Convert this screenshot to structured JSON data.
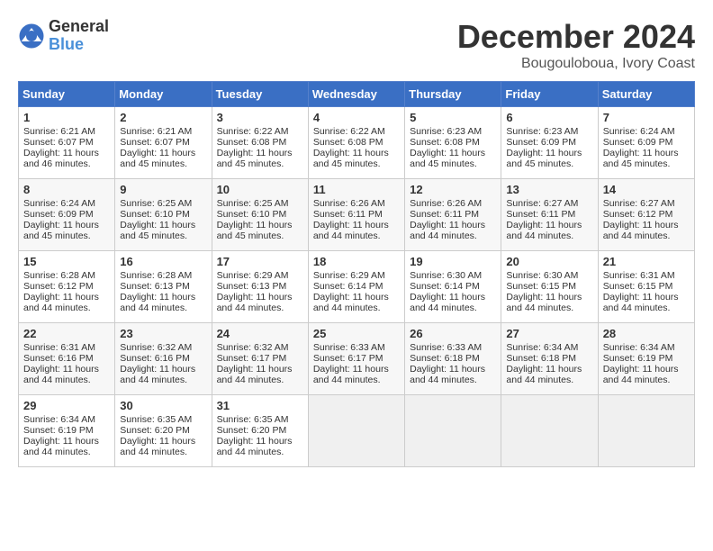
{
  "logo": {
    "general": "General",
    "blue": "Blue"
  },
  "title": "December 2024",
  "location": "Bougouloboua, Ivory Coast",
  "days_of_week": [
    "Sunday",
    "Monday",
    "Tuesday",
    "Wednesday",
    "Thursday",
    "Friday",
    "Saturday"
  ],
  "weeks": [
    [
      {
        "day": "1",
        "sunrise": "Sunrise: 6:21 AM",
        "sunset": "Sunset: 6:07 PM",
        "daylight": "Daylight: 11 hours and 46 minutes."
      },
      {
        "day": "2",
        "sunrise": "Sunrise: 6:21 AM",
        "sunset": "Sunset: 6:07 PM",
        "daylight": "Daylight: 11 hours and 45 minutes."
      },
      {
        "day": "3",
        "sunrise": "Sunrise: 6:22 AM",
        "sunset": "Sunset: 6:08 PM",
        "daylight": "Daylight: 11 hours and 45 minutes."
      },
      {
        "day": "4",
        "sunrise": "Sunrise: 6:22 AM",
        "sunset": "Sunset: 6:08 PM",
        "daylight": "Daylight: 11 hours and 45 minutes."
      },
      {
        "day": "5",
        "sunrise": "Sunrise: 6:23 AM",
        "sunset": "Sunset: 6:08 PM",
        "daylight": "Daylight: 11 hours and 45 minutes."
      },
      {
        "day": "6",
        "sunrise": "Sunrise: 6:23 AM",
        "sunset": "Sunset: 6:09 PM",
        "daylight": "Daylight: 11 hours and 45 minutes."
      },
      {
        "day": "7",
        "sunrise": "Sunrise: 6:24 AM",
        "sunset": "Sunset: 6:09 PM",
        "daylight": "Daylight: 11 hours and 45 minutes."
      }
    ],
    [
      {
        "day": "8",
        "sunrise": "Sunrise: 6:24 AM",
        "sunset": "Sunset: 6:09 PM",
        "daylight": "Daylight: 11 hours and 45 minutes."
      },
      {
        "day": "9",
        "sunrise": "Sunrise: 6:25 AM",
        "sunset": "Sunset: 6:10 PM",
        "daylight": "Daylight: 11 hours and 45 minutes."
      },
      {
        "day": "10",
        "sunrise": "Sunrise: 6:25 AM",
        "sunset": "Sunset: 6:10 PM",
        "daylight": "Daylight: 11 hours and 45 minutes."
      },
      {
        "day": "11",
        "sunrise": "Sunrise: 6:26 AM",
        "sunset": "Sunset: 6:11 PM",
        "daylight": "Daylight: 11 hours and 44 minutes."
      },
      {
        "day": "12",
        "sunrise": "Sunrise: 6:26 AM",
        "sunset": "Sunset: 6:11 PM",
        "daylight": "Daylight: 11 hours and 44 minutes."
      },
      {
        "day": "13",
        "sunrise": "Sunrise: 6:27 AM",
        "sunset": "Sunset: 6:11 PM",
        "daylight": "Daylight: 11 hours and 44 minutes."
      },
      {
        "day": "14",
        "sunrise": "Sunrise: 6:27 AM",
        "sunset": "Sunset: 6:12 PM",
        "daylight": "Daylight: 11 hours and 44 minutes."
      }
    ],
    [
      {
        "day": "15",
        "sunrise": "Sunrise: 6:28 AM",
        "sunset": "Sunset: 6:12 PM",
        "daylight": "Daylight: 11 hours and 44 minutes."
      },
      {
        "day": "16",
        "sunrise": "Sunrise: 6:28 AM",
        "sunset": "Sunset: 6:13 PM",
        "daylight": "Daylight: 11 hours and 44 minutes."
      },
      {
        "day": "17",
        "sunrise": "Sunrise: 6:29 AM",
        "sunset": "Sunset: 6:13 PM",
        "daylight": "Daylight: 11 hours and 44 minutes."
      },
      {
        "day": "18",
        "sunrise": "Sunrise: 6:29 AM",
        "sunset": "Sunset: 6:14 PM",
        "daylight": "Daylight: 11 hours and 44 minutes."
      },
      {
        "day": "19",
        "sunrise": "Sunrise: 6:30 AM",
        "sunset": "Sunset: 6:14 PM",
        "daylight": "Daylight: 11 hours and 44 minutes."
      },
      {
        "day": "20",
        "sunrise": "Sunrise: 6:30 AM",
        "sunset": "Sunset: 6:15 PM",
        "daylight": "Daylight: 11 hours and 44 minutes."
      },
      {
        "day": "21",
        "sunrise": "Sunrise: 6:31 AM",
        "sunset": "Sunset: 6:15 PM",
        "daylight": "Daylight: 11 hours and 44 minutes."
      }
    ],
    [
      {
        "day": "22",
        "sunrise": "Sunrise: 6:31 AM",
        "sunset": "Sunset: 6:16 PM",
        "daylight": "Daylight: 11 hours and 44 minutes."
      },
      {
        "day": "23",
        "sunrise": "Sunrise: 6:32 AM",
        "sunset": "Sunset: 6:16 PM",
        "daylight": "Daylight: 11 hours and 44 minutes."
      },
      {
        "day": "24",
        "sunrise": "Sunrise: 6:32 AM",
        "sunset": "Sunset: 6:17 PM",
        "daylight": "Daylight: 11 hours and 44 minutes."
      },
      {
        "day": "25",
        "sunrise": "Sunrise: 6:33 AM",
        "sunset": "Sunset: 6:17 PM",
        "daylight": "Daylight: 11 hours and 44 minutes."
      },
      {
        "day": "26",
        "sunrise": "Sunrise: 6:33 AM",
        "sunset": "Sunset: 6:18 PM",
        "daylight": "Daylight: 11 hours and 44 minutes."
      },
      {
        "day": "27",
        "sunrise": "Sunrise: 6:34 AM",
        "sunset": "Sunset: 6:18 PM",
        "daylight": "Daylight: 11 hours and 44 minutes."
      },
      {
        "day": "28",
        "sunrise": "Sunrise: 6:34 AM",
        "sunset": "Sunset: 6:19 PM",
        "daylight": "Daylight: 11 hours and 44 minutes."
      }
    ],
    [
      {
        "day": "29",
        "sunrise": "Sunrise: 6:34 AM",
        "sunset": "Sunset: 6:19 PM",
        "daylight": "Daylight: 11 hours and 44 minutes."
      },
      {
        "day": "30",
        "sunrise": "Sunrise: 6:35 AM",
        "sunset": "Sunset: 6:20 PM",
        "daylight": "Daylight: 11 hours and 44 minutes."
      },
      {
        "day": "31",
        "sunrise": "Sunrise: 6:35 AM",
        "sunset": "Sunset: 6:20 PM",
        "daylight": "Daylight: 11 hours and 44 minutes."
      },
      null,
      null,
      null,
      null
    ]
  ]
}
